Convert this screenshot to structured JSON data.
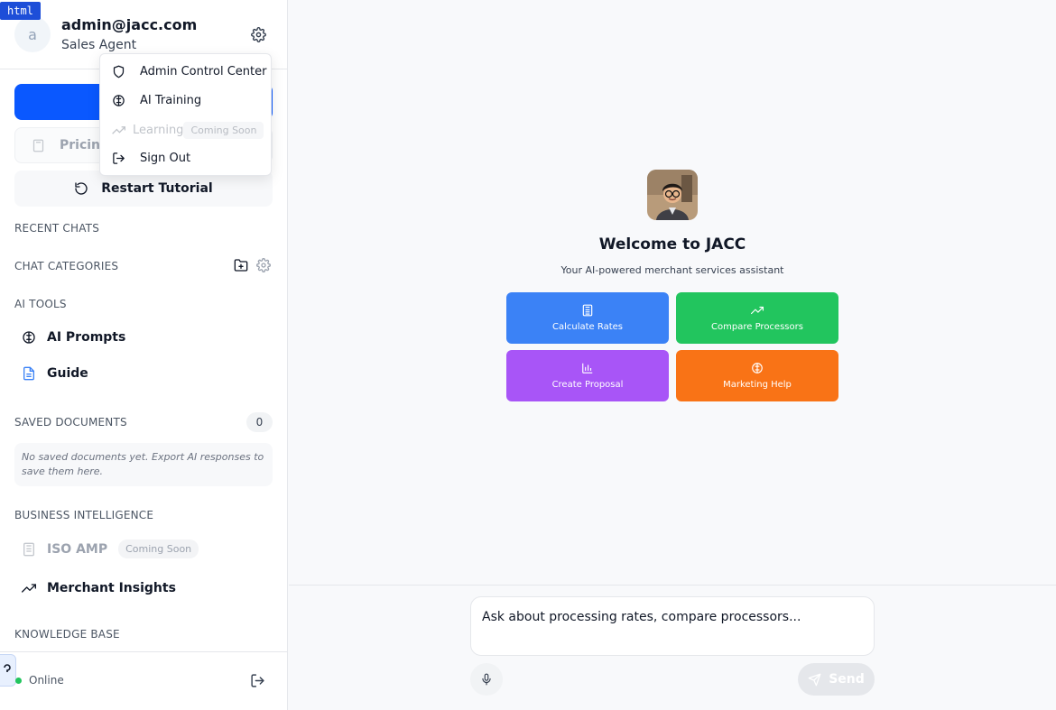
{
  "overlay_tag": "html",
  "profile": {
    "initial": "a",
    "email": "admin@jacc.com",
    "role": "Sales Agent"
  },
  "menu": {
    "items": [
      {
        "label": "Admin Control Center",
        "icon": "shield-icon"
      },
      {
        "label": "AI Training",
        "icon": "brain-icon"
      },
      {
        "label": "Learning",
        "icon": "trending-up-icon",
        "badge": "Coming Soon",
        "disabled": true
      },
      {
        "label": "Sign Out",
        "icon": "log-out-icon"
      }
    ]
  },
  "sidebar": {
    "pricing_label": "Pricing",
    "restart_label": "Restart Tutorial",
    "recent_chats_label": "RECENT CHATS",
    "chat_categories_label": "CHAT CATEGORIES",
    "ai_tools_label": "AI TOOLS",
    "ai_tools": [
      {
        "label": "AI Prompts",
        "icon": "brain-icon"
      },
      {
        "label": "Guide",
        "icon": "document-icon"
      }
    ],
    "saved_documents_label": "SAVED DOCUMENTS",
    "saved_documents_count": "0",
    "saved_documents_empty": "No saved documents yet. Export AI responses to save them here.",
    "business_intelligence_label": "BUSINESS INTELLIGENCE",
    "iso_amp_label": "ISO AMP",
    "iso_amp_badge": "Coming Soon",
    "merchant_insights_label": "Merchant Insights",
    "knowledge_base_label": "KNOWLEDGE BASE",
    "status_label": "Online"
  },
  "main": {
    "welcome_title": "Welcome to JACC",
    "tagline": "Your AI-powered merchant services assistant",
    "quick_actions": [
      {
        "label": "Calculate Rates",
        "icon": "calculator-icon",
        "color": "#3b82f6"
      },
      {
        "label": "Compare Processors",
        "icon": "trending-up-icon",
        "color": "#22c55e"
      },
      {
        "label": "Create Proposal",
        "icon": "bar-chart-icon",
        "color": "#a855f7"
      },
      {
        "label": "Marketing Help",
        "icon": "brain-icon",
        "color": "#f97316"
      }
    ],
    "composer_placeholder": "Ask about processing rates, compare processors...",
    "send_label": "Send"
  },
  "colors": {
    "primary": "#0a58ff",
    "online": "#22c55e"
  }
}
